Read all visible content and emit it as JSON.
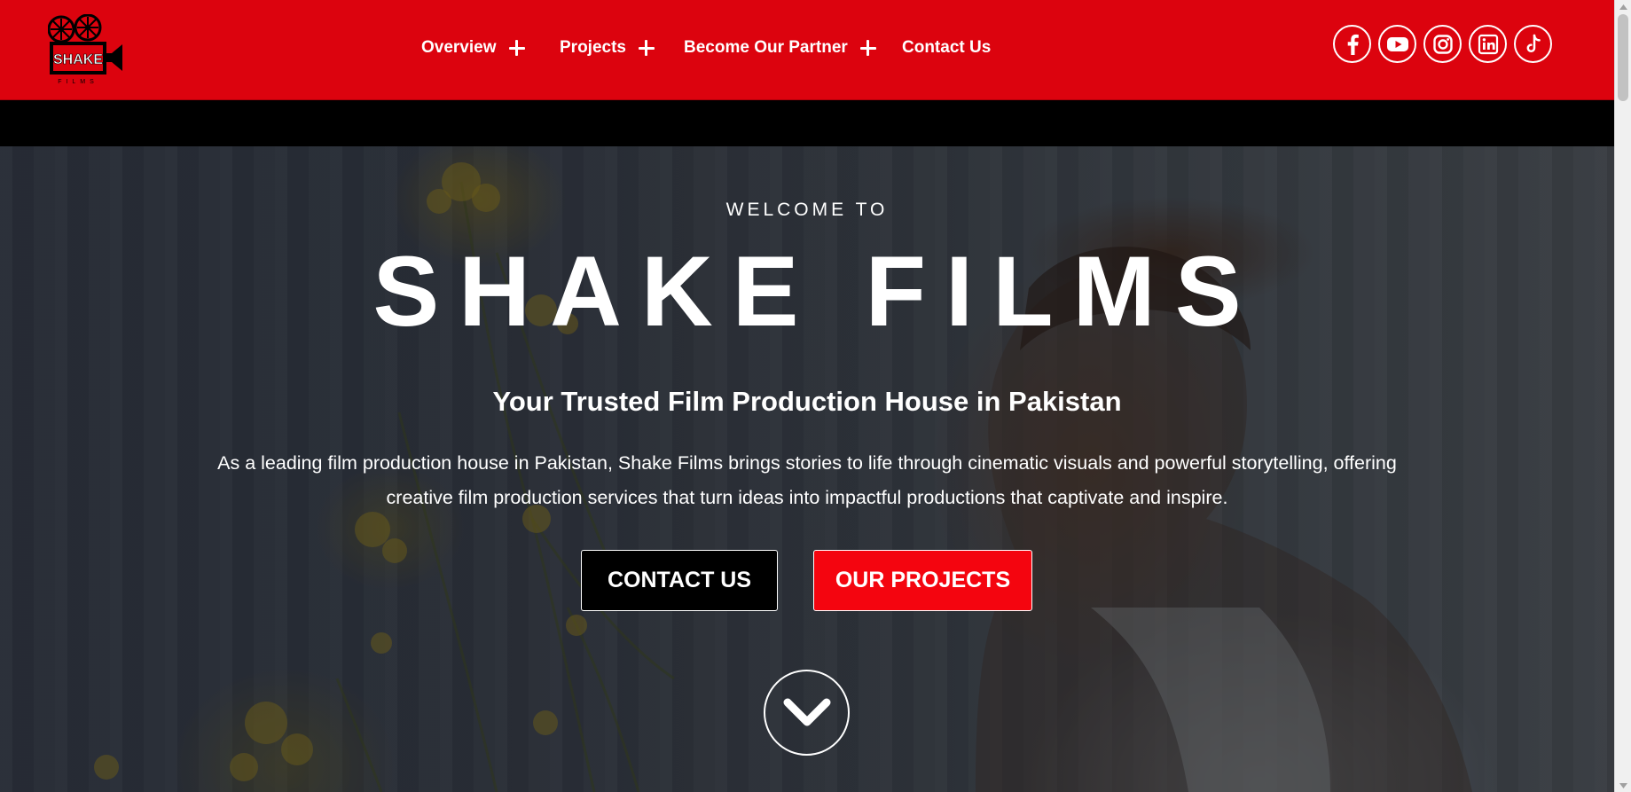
{
  "header": {
    "logo": {
      "text": "SHAKE",
      "subtext": "FILMS",
      "icon": "film-camera-icon"
    },
    "nav": [
      {
        "label": "Overview",
        "has_submenu": true
      },
      {
        "label": "Projects",
        "has_submenu": true
      },
      {
        "label": "Become Our Partner",
        "has_submenu": true
      },
      {
        "label": "Contact Us",
        "has_submenu": false
      }
    ],
    "socials": [
      "facebook-icon",
      "youtube-icon",
      "instagram-icon",
      "linkedin-icon",
      "tiktok-icon"
    ]
  },
  "hero": {
    "welcome": "WELCOME TO",
    "title": "SHAKE FILMS",
    "tagline": "Your Trusted Film Production House in Pakistan",
    "description": "As a leading film production house in Pakistan, Shake Films brings stories to life through cinematic visuals and powerful storytelling, offering creative film production services that turn ideas into impactful productions that captivate and inspire.",
    "buttons": {
      "contact": "CONTACT US",
      "projects": "OUR PROJECTS"
    },
    "scroll_icon": "chevron-down-icon"
  },
  "colors": {
    "brand_red": "#dc030e",
    "button_red": "#f4050f",
    "text": "#ffffff",
    "dark": "#000000"
  }
}
